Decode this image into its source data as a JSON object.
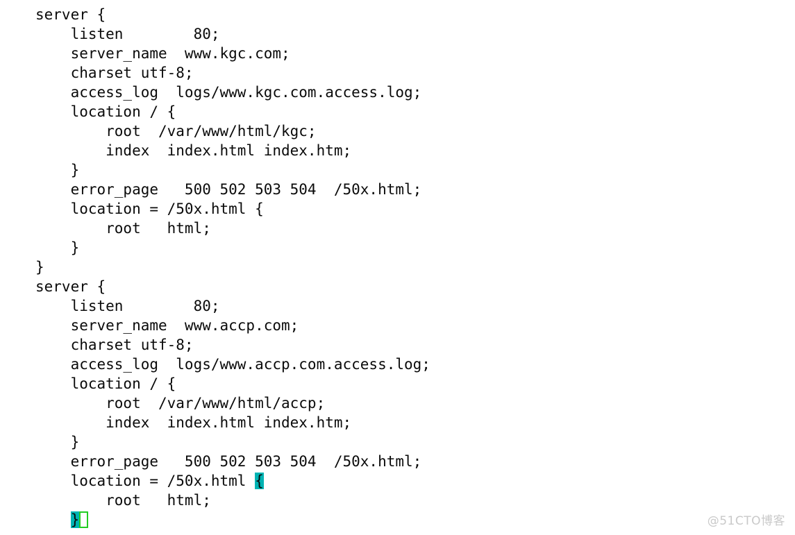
{
  "editor": {
    "background_color": "#ffffff",
    "text_color": "#0a0a0a",
    "match_highlight_color": "#00b3b3",
    "cursor_border_color": "#22cc22",
    "font_size_px": 21,
    "line_height_px": 28,
    "lines": [
      "server {",
      "    listen        80;",
      "    server_name  www.kgc.com;",
      "    charset utf-8;",
      "    access_log  logs/www.kgc.com.access.log;",
      "    location / {",
      "        root  /var/www/html/kgc;",
      "        index  index.html index.htm;",
      "    }",
      "    error_page   500 502 503 504  /50x.html;",
      "    location = /50x.html {",
      "        root   html;",
      "    }",
      "}",
      "server {",
      "    listen        80;",
      "    server_name  www.accp.com;",
      "    charset utf-8;",
      "    access_log  logs/www.accp.com.access.log;",
      "    location / {",
      "        root  /var/www/html/accp;",
      "        index  index.html index.htm;",
      "    }",
      "    error_page   500 502 503 504  /50x.html;"
    ],
    "highlighted_open_line": {
      "prefix": "    location = /50x.html ",
      "match_char": "{",
      "suffix": ""
    },
    "root_html_line": "        root   html;",
    "highlighted_close_line": {
      "prefix": "    ",
      "match_char": "}",
      "cursor_char": " "
    }
  },
  "watermark": {
    "text": "@51CTO博客"
  }
}
